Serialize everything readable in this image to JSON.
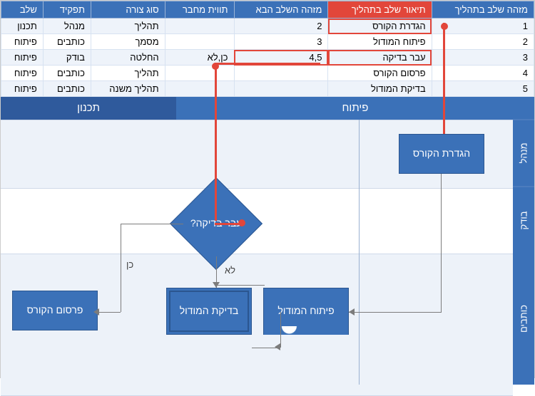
{
  "table": {
    "headers": {
      "id": "מזהה שלב בתהליך",
      "desc": "תיאור שלב בתהליך",
      "next": "מזהה השלב הבא",
      "connLabel": "תווית מחבר",
      "shape": "סוג צורה",
      "role": "תפקיד",
      "phase": "שלב"
    },
    "rows": [
      {
        "id": "1",
        "desc": "הגדרת הקורס",
        "next": "2",
        "connLabel": "",
        "shape": "תהליך",
        "role": "מנהל",
        "phase": "תכנון"
      },
      {
        "id": "2",
        "desc": "פיתוח המודול",
        "next": "3",
        "connLabel": "",
        "shape": "מסמך",
        "role": "כותבים",
        "phase": "פיתוח"
      },
      {
        "id": "3",
        "desc": "עבר בדיקה",
        "next": "4,5",
        "connLabel": "כן,לא",
        "shape": "החלטה",
        "role": "בודק",
        "phase": "פיתוח"
      },
      {
        "id": "4",
        "desc": "פרסום הקורס",
        "next": "",
        "connLabel": "",
        "shape": "תהליך",
        "role": "כותבים",
        "phase": "פיתוח"
      },
      {
        "id": "5",
        "desc": "בדיקת המודול",
        "next": "",
        "connLabel": "",
        "shape": "תהליך משנה",
        "role": "כותבים",
        "phase": "פיתוח"
      }
    ]
  },
  "phases": {
    "planning": "תכנון",
    "development": "פיתוח"
  },
  "lanes": {
    "manager": "מנהל",
    "tester": "בודק",
    "writers": "כותבים"
  },
  "nodes": {
    "define": "הגדרת הקורס",
    "develop": "פיתוח המודול",
    "check": "בדיקת המודול",
    "publish": "פרסום הקורס",
    "decision": "עבר בדיקה?"
  },
  "edges": {
    "yes": "כן",
    "no": "לא"
  }
}
